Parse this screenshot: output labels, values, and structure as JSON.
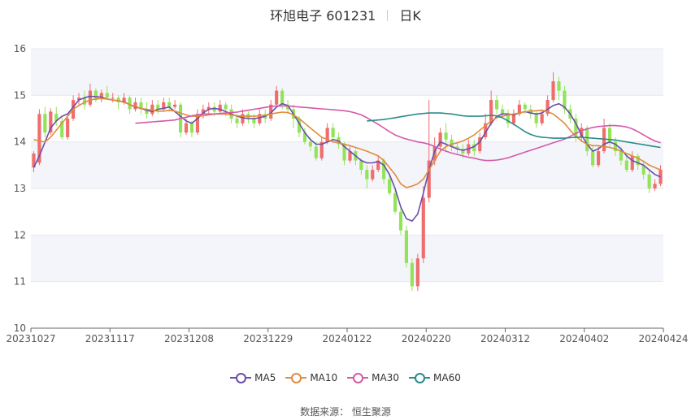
{
  "title": {
    "name": "环旭电子 601231",
    "period": "日K"
  },
  "source": "数据来源：  恒生聚源",
  "chart_data": {
    "type": "candlestick",
    "x_ticks": [
      "20231027",
      "20231117",
      "20231208",
      "20231229",
      "20240122",
      "20240220",
      "20240312",
      "20240402",
      "20240424"
    ],
    "y_ticks": [
      10,
      11,
      12,
      13,
      14,
      15,
      16
    ],
    "ylim": [
      10,
      16
    ],
    "grid": true,
    "legend_position": "bottom",
    "colors": {
      "up": "#ee6d6d",
      "down": "#93e35a",
      "grid": "#e8e8ee",
      "band": "#f4f5fa"
    },
    "candles": [
      [
        13.45,
        13.75,
        13.35,
        13.8
      ],
      [
        13.55,
        14.6,
        13.5,
        14.7
      ],
      [
        14.6,
        14.2,
        14.1,
        14.75
      ],
      [
        14.2,
        14.65,
        14.15,
        14.72
      ],
      [
        14.6,
        14.45,
        14.35,
        14.75
      ],
      [
        14.45,
        14.1,
        14.05,
        14.55
      ],
      [
        14.1,
        14.5,
        14.05,
        14.6
      ],
      [
        14.5,
        14.9,
        14.45,
        15.0
      ],
      [
        14.9,
        14.95,
        14.8,
        15.05
      ],
      [
        14.95,
        14.8,
        14.7,
        15.1
      ],
      [
        14.8,
        15.1,
        14.75,
        15.25
      ],
      [
        15.1,
        14.9,
        14.85,
        15.15
      ],
      [
        14.95,
        15.05,
        14.85,
        15.12
      ],
      [
        15.05,
        14.95,
        14.9,
        15.2
      ],
      [
        14.95,
        14.95,
        14.85,
        15.05
      ],
      [
        14.95,
        14.85,
        14.7,
        15.0
      ],
      [
        14.85,
        14.95,
        14.8,
        15.05
      ],
      [
        14.95,
        14.7,
        14.6,
        15.0
      ],
      [
        14.7,
        14.85,
        14.65,
        14.95
      ],
      [
        14.85,
        14.7,
        14.6,
        14.95
      ],
      [
        14.7,
        14.6,
        14.5,
        14.85
      ],
      [
        14.6,
        14.8,
        14.55,
        14.9
      ],
      [
        14.8,
        14.7,
        14.6,
        14.9
      ],
      [
        14.7,
        14.85,
        14.65,
        14.95
      ],
      [
        14.85,
        14.75,
        14.65,
        14.95
      ],
      [
        14.75,
        14.8,
        14.7,
        14.9
      ],
      [
        14.8,
        14.2,
        14.1,
        14.85
      ],
      [
        14.2,
        14.4,
        14.15,
        14.5
      ],
      [
        14.4,
        14.2,
        14.1,
        14.45
      ],
      [
        14.2,
        14.6,
        14.15,
        14.7
      ],
      [
        14.6,
        14.7,
        14.5,
        14.8
      ],
      [
        14.7,
        14.75,
        14.6,
        14.85
      ],
      [
        14.75,
        14.65,
        14.55,
        14.85
      ],
      [
        14.65,
        14.8,
        14.6,
        14.9
      ],
      [
        14.8,
        14.7,
        14.55,
        14.85
      ],
      [
        14.7,
        14.5,
        14.4,
        14.8
      ],
      [
        14.5,
        14.4,
        14.3,
        14.6
      ],
      [
        14.4,
        14.6,
        14.35,
        14.7
      ],
      [
        14.6,
        14.5,
        14.4,
        14.65
      ],
      [
        14.5,
        14.4,
        14.3,
        14.6
      ],
      [
        14.4,
        14.6,
        14.35,
        14.7
      ],
      [
        14.6,
        14.5,
        14.4,
        14.7
      ],
      [
        14.5,
        14.8,
        14.45,
        14.9
      ],
      [
        14.8,
        15.1,
        14.75,
        15.2
      ],
      [
        15.1,
        14.8,
        14.7,
        15.15
      ],
      [
        14.8,
        14.7,
        14.6,
        14.9
      ],
      [
        14.7,
        14.5,
        14.3,
        14.8
      ],
      [
        14.5,
        14.2,
        14.1,
        14.55
      ],
      [
        14.2,
        14.0,
        13.95,
        14.3
      ],
      [
        14.0,
        13.9,
        13.8,
        14.1
      ],
      [
        13.9,
        13.65,
        13.6,
        14.0
      ],
      [
        13.65,
        14.0,
        13.6,
        14.1
      ],
      [
        14.0,
        14.3,
        13.95,
        14.4
      ],
      [
        14.3,
        14.1,
        14.0,
        14.4
      ],
      [
        14.1,
        13.95,
        13.85,
        14.2
      ],
      [
        13.95,
        13.6,
        13.5,
        14.0
      ],
      [
        13.6,
        13.8,
        13.55,
        13.9
      ],
      [
        13.8,
        13.6,
        13.5,
        13.85
      ],
      [
        13.6,
        13.4,
        13.3,
        13.65
      ],
      [
        13.4,
        13.2,
        13.0,
        13.5
      ],
      [
        13.2,
        13.4,
        13.15,
        13.5
      ],
      [
        13.4,
        13.6,
        13.35,
        13.7
      ],
      [
        13.6,
        13.2,
        13.1,
        13.65
      ],
      [
        13.2,
        12.9,
        12.85,
        13.3
      ],
      [
        12.9,
        12.5,
        12.45,
        13.0
      ],
      [
        12.5,
        12.1,
        12.0,
        12.6
      ],
      [
        12.1,
        11.4,
        11.3,
        12.2
      ],
      [
        11.4,
        10.9,
        10.8,
        11.5
      ],
      [
        10.9,
        11.5,
        10.8,
        11.6
      ],
      [
        11.5,
        12.8,
        11.4,
        13.05
      ],
      [
        12.8,
        13.6,
        12.7,
        14.9
      ],
      [
        13.6,
        13.9,
        13.5,
        14.1
      ],
      [
        13.9,
        14.2,
        13.8,
        14.3
      ],
      [
        14.2,
        14.05,
        13.8,
        14.4
      ],
      [
        14.05,
        13.9,
        13.8,
        14.15
      ],
      [
        13.9,
        13.85,
        13.75,
        14.0
      ],
      [
        13.85,
        13.75,
        13.65,
        13.95
      ],
      [
        13.75,
        13.95,
        13.7,
        14.05
      ],
      [
        13.95,
        13.8,
        13.7,
        14.05
      ],
      [
        13.8,
        14.1,
        13.75,
        14.2
      ],
      [
        14.1,
        14.4,
        14.05,
        14.6
      ],
      [
        14.4,
        14.9,
        14.35,
        15.1
      ],
      [
        14.9,
        14.7,
        14.6,
        15.0
      ],
      [
        14.7,
        14.6,
        14.5,
        14.8
      ],
      [
        14.6,
        14.4,
        14.3,
        14.7
      ],
      [
        14.4,
        14.6,
        14.35,
        14.7
      ],
      [
        14.6,
        14.8,
        14.55,
        14.9
      ],
      [
        14.8,
        14.7,
        14.6,
        14.85
      ],
      [
        14.7,
        14.6,
        14.5,
        14.8
      ],
      [
        14.6,
        14.4,
        14.3,
        14.65
      ],
      [
        14.4,
        14.6,
        14.35,
        14.7
      ],
      [
        14.6,
        14.9,
        14.55,
        15.0
      ],
      [
        14.9,
        15.3,
        14.85,
        15.5
      ],
      [
        15.3,
        15.1,
        14.9,
        15.4
      ],
      [
        15.1,
        14.7,
        14.6,
        15.2
      ],
      [
        14.7,
        14.5,
        14.4,
        14.8
      ],
      [
        14.5,
        14.1,
        14.0,
        14.6
      ],
      [
        14.1,
        14.3,
        14.0,
        14.4
      ],
      [
        14.3,
        13.8,
        13.7,
        14.35
      ],
      [
        13.8,
        13.5,
        13.45,
        13.9
      ],
      [
        13.5,
        13.8,
        13.45,
        13.9
      ],
      [
        13.8,
        14.3,
        13.75,
        14.5
      ],
      [
        14.3,
        14.0,
        13.9,
        14.4
      ],
      [
        14.0,
        13.8,
        13.7,
        14.1
      ],
      [
        13.8,
        13.6,
        13.5,
        13.9
      ],
      [
        13.6,
        13.4,
        13.35,
        13.7
      ],
      [
        13.4,
        13.7,
        13.35,
        13.8
      ],
      [
        13.7,
        13.5,
        13.4,
        13.75
      ],
      [
        13.5,
        13.3,
        13.2,
        13.6
      ],
      [
        13.3,
        13.0,
        12.9,
        13.4
      ],
      [
        13.0,
        13.1,
        12.95,
        13.2
      ],
      [
        13.1,
        13.4,
        13.05,
        13.5
      ]
    ],
    "series": [
      {
        "name": "MA5",
        "color": "#6b4ea8",
        "values": [
          13.45,
          13.7,
          14.0,
          14.3,
          14.45,
          14.55,
          14.6,
          14.75,
          14.9,
          14.95,
          14.98,
          14.97,
          14.96,
          14.92,
          14.9,
          14.88,
          14.86,
          14.8,
          14.75,
          14.72,
          14.68,
          14.65,
          14.7,
          14.72,
          14.75,
          14.65,
          14.55,
          14.45,
          14.4,
          14.5,
          14.62,
          14.7,
          14.72,
          14.7,
          14.65,
          14.6,
          14.55,
          14.52,
          14.5,
          14.5,
          14.52,
          14.55,
          14.62,
          14.75,
          14.82,
          14.78,
          14.6,
          14.4,
          14.2,
          14.05,
          13.95,
          13.95,
          14.0,
          14.05,
          14.02,
          13.9,
          13.8,
          13.7,
          13.6,
          13.55,
          13.55,
          13.58,
          13.5,
          13.3,
          13.0,
          12.6,
          12.35,
          12.3,
          12.45,
          12.9,
          13.4,
          13.8,
          14.0,
          13.95,
          13.9,
          13.85,
          13.82,
          13.85,
          13.9,
          14.0,
          14.2,
          14.4,
          14.55,
          14.6,
          14.6,
          14.58,
          14.62,
          14.65,
          14.62,
          14.6,
          14.62,
          14.7,
          14.78,
          14.82,
          14.75,
          14.6,
          14.4,
          14.15,
          13.95,
          13.8,
          13.85,
          13.95,
          14.0,
          13.95,
          13.85,
          13.7,
          13.6,
          13.55,
          13.5,
          13.4,
          13.3,
          13.25
        ]
      },
      {
        "name": "MA10",
        "color": "#e08c3c",
        "values": [
          14.05,
          14.02,
          14.0,
          14.1,
          14.25,
          14.4,
          14.55,
          14.7,
          14.78,
          14.85,
          14.9,
          14.92,
          14.93,
          14.92,
          14.9,
          14.88,
          14.85,
          14.8,
          14.76,
          14.72,
          14.7,
          14.68,
          14.66,
          14.66,
          14.68,
          14.66,
          14.62,
          14.58,
          14.55,
          14.55,
          14.56,
          14.58,
          14.6,
          14.6,
          14.6,
          14.58,
          14.56,
          14.55,
          14.55,
          14.55,
          14.56,
          14.57,
          14.6,
          14.62,
          14.64,
          14.63,
          14.58,
          14.5,
          14.4,
          14.3,
          14.2,
          14.1,
          14.05,
          14.0,
          13.98,
          13.95,
          13.92,
          13.88,
          13.84,
          13.8,
          13.75,
          13.7,
          13.6,
          13.45,
          13.3,
          13.1,
          13.02,
          13.05,
          13.1,
          13.2,
          13.4,
          13.6,
          13.8,
          13.9,
          13.95,
          13.98,
          14.02,
          14.08,
          14.15,
          14.25,
          14.35,
          14.45,
          14.52,
          14.55,
          14.58,
          14.6,
          14.62,
          14.65,
          14.66,
          14.67,
          14.68,
          14.65,
          14.6,
          14.5,
          14.4,
          14.25,
          14.12,
          14.02,
          13.95,
          13.92,
          13.92,
          13.9,
          13.88,
          13.85,
          13.8,
          13.75,
          13.7,
          13.65,
          13.58,
          13.5,
          13.45,
          13.4
        ]
      },
      {
        "name": "MA30",
        "color": "#d45aa8",
        "values": [
          14.4,
          14.41,
          14.42,
          14.43,
          14.44,
          14.45,
          14.46,
          14.47,
          14.5,
          14.53,
          14.56,
          14.58,
          14.6,
          14.6,
          14.6,
          14.61,
          14.62,
          14.63,
          14.64,
          14.66,
          14.68,
          14.7,
          14.72,
          14.74,
          14.76,
          14.77,
          14.77,
          14.77,
          14.76,
          14.75,
          14.74,
          14.73,
          14.72,
          14.71,
          14.7,
          14.69,
          14.68,
          14.67,
          14.65,
          14.62,
          14.58,
          14.52,
          14.45,
          14.38,
          14.3,
          14.22,
          14.15,
          14.1,
          14.06,
          14.03,
          14.0,
          13.98,
          13.95,
          13.9,
          13.85,
          13.8,
          13.76,
          13.73,
          13.7,
          13.67,
          13.65,
          13.62,
          13.6,
          13.6,
          13.61,
          13.63,
          13.66,
          13.7,
          13.74,
          13.78,
          13.82,
          13.86,
          13.9,
          13.94,
          13.98,
          14.02,
          14.06,
          14.12,
          14.18,
          14.24,
          14.28,
          14.31,
          14.33,
          14.34,
          14.35,
          14.35,
          14.34,
          14.32,
          14.28,
          14.22,
          14.15,
          14.08,
          14.02,
          13.98
        ]
      },
      {
        "name": "MA60",
        "color": "#2a8c8c",
        "values": [
          14.45,
          14.46,
          14.47,
          14.48,
          14.5,
          14.52,
          14.54,
          14.56,
          14.58,
          14.6,
          14.61,
          14.62,
          14.62,
          14.62,
          14.61,
          14.6,
          14.58,
          14.56,
          14.55,
          14.55,
          14.55,
          14.56,
          14.57,
          14.56,
          14.52,
          14.45,
          14.38,
          14.3,
          14.22,
          14.16,
          14.12,
          14.1,
          14.09,
          14.08,
          14.08,
          14.08,
          14.09,
          14.1,
          14.1,
          14.09,
          14.08,
          14.07,
          14.06,
          14.05,
          14.04,
          14.02,
          14.0,
          13.98,
          13.96,
          13.94,
          13.92,
          13.9,
          13.88
        ]
      }
    ]
  }
}
